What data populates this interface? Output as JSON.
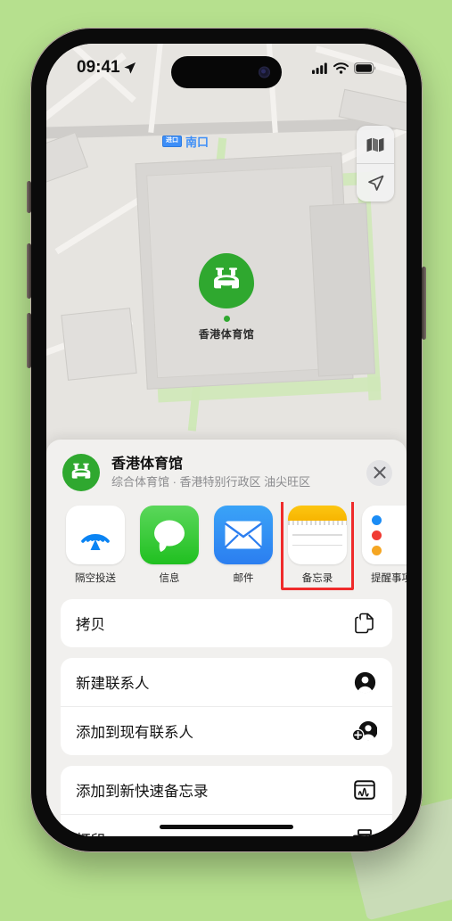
{
  "background": {
    "color": "#b6e08e"
  },
  "status_bar": {
    "time": "09:41",
    "location_icon": "location-arrow-icon",
    "cellular_icon": "cellular-signal-icon",
    "wifi_icon": "wifi-icon",
    "battery_icon": "battery-full-icon"
  },
  "map": {
    "controls": [
      {
        "name": "map-layers-icon",
        "label": "地图"
      },
      {
        "name": "locate-me-icon",
        "label": "定位"
      }
    ],
    "entrance_label": {
      "badge": "进口",
      "text": "南口"
    },
    "pin": {
      "label": "香港体育馆",
      "color": "#2fa82f",
      "icon": "stadium-icon"
    }
  },
  "share_sheet": {
    "title": "香港体育馆",
    "subtitle": "综合体育馆 · 香港特别行政区 油尖旺区",
    "avatar_icon": "stadium-icon",
    "close_label": "×",
    "apps": [
      {
        "label": "隔空投送",
        "icon": "airdrop-icon",
        "highlighted": false
      },
      {
        "label": "信息",
        "icon": "messages-icon",
        "highlighted": false
      },
      {
        "label": "邮件",
        "icon": "mail-icon",
        "highlighted": false
      },
      {
        "label": "备忘录",
        "icon": "notes-icon",
        "highlighted": true
      },
      {
        "label": "提醒事项",
        "icon": "reminders-icon",
        "highlighted": false
      }
    ],
    "actions": [
      {
        "label": "拷贝",
        "icon": "copy-icon"
      },
      {
        "label": "新建联系人",
        "icon": "new-contact-icon"
      },
      {
        "label": "添加到现有联系人",
        "icon": "add-to-contact-icon"
      },
      {
        "label": "添加到新快速备忘录",
        "icon": "quick-note-icon"
      },
      {
        "label": "打印",
        "icon": "printer-icon"
      }
    ]
  },
  "highlight": {
    "color": "#ef2b2b",
    "target": "备忘录"
  }
}
